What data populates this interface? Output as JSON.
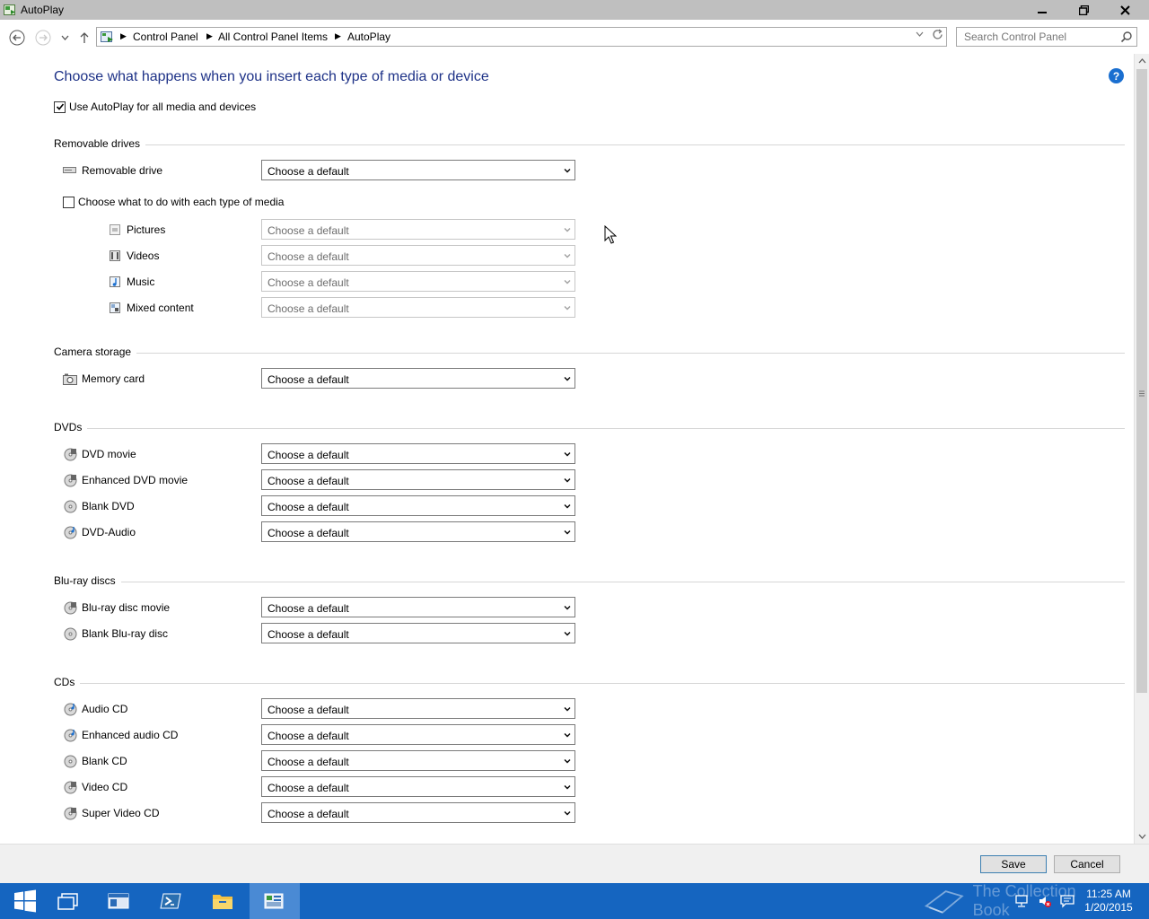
{
  "window": {
    "title": "AutoPlay",
    "minimize": "🗕",
    "restore": "🗗",
    "close": "✕"
  },
  "nav": {
    "breadcrumb": [
      "Control Panel",
      "All Control Panel Items",
      "AutoPlay"
    ],
    "search_placeholder": "Search Control Panel"
  },
  "page": {
    "heading": "Choose what happens when you insert each type of media or device",
    "use_autoplay_label": "Use AutoPlay for all media and devices",
    "use_autoplay_checked": true,
    "help": "?"
  },
  "default_option": "Choose a default",
  "sections": {
    "removable": {
      "title": "Removable drives",
      "removable_drive": "Removable drive",
      "per_media_label": "Choose what to do with each type of media",
      "per_media_checked": false,
      "pictures": "Pictures",
      "videos": "Videos",
      "music": "Music",
      "mixed": "Mixed content"
    },
    "camera": {
      "title": "Camera storage",
      "memory_card": "Memory card"
    },
    "dvds": {
      "title": "DVDs",
      "dvd_movie": "DVD movie",
      "enhanced_dvd_movie": "Enhanced DVD movie",
      "blank_dvd": "Blank DVD",
      "dvd_audio": "DVD-Audio"
    },
    "bluray": {
      "title": "Blu-ray discs",
      "bluray_movie": "Blu-ray disc movie",
      "blank_bluray": "Blank Blu-ray disc"
    },
    "cds": {
      "title": "CDs",
      "audio_cd": "Audio CD",
      "enhanced_audio_cd": "Enhanced audio CD",
      "blank_cd": "Blank CD",
      "video_cd": "Video CD",
      "super_video_cd": "Super Video CD"
    }
  },
  "footer": {
    "save": "Save",
    "cancel": "Cancel"
  },
  "taskbar": {
    "watermark": "The Collection Book",
    "time": "11:25 AM",
    "date": "1/20/2015"
  },
  "colors": {
    "heading": "#1e3287",
    "taskbar": "#1565c0",
    "titlebar": "#bfbfbf"
  }
}
